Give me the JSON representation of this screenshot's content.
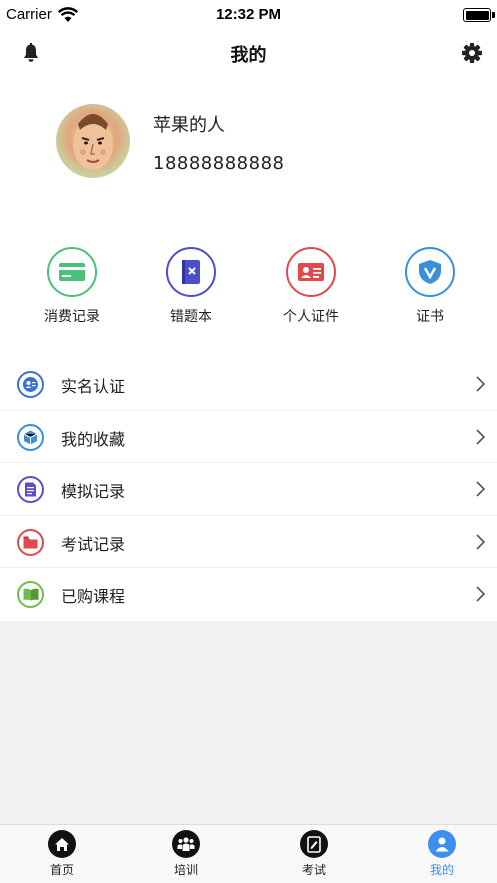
{
  "status_bar": {
    "carrier": "Carrier",
    "time": "12:32 PM"
  },
  "nav": {
    "title": "我的",
    "left_icon": "bell-icon",
    "right_icon": "gear-icon"
  },
  "profile": {
    "name": "苹果的人",
    "phone": "18888888888"
  },
  "quick_actions": [
    {
      "label": "消费记录",
      "icon": "payment-card-icon",
      "color": "#4cc17a"
    },
    {
      "label": "错题本",
      "icon": "wrong-notebook-icon",
      "color": "#4b4fc9"
    },
    {
      "label": "个人证件",
      "icon": "id-card-icon",
      "color": "#e04a4a"
    },
    {
      "label": "证书",
      "icon": "shield-certificate-icon",
      "color": "#3a8fd9"
    }
  ],
  "menu": [
    {
      "label": "实名认证",
      "icon": "identity-icon",
      "color": "#3b6fd9"
    },
    {
      "label": "我的收藏",
      "icon": "box-icon",
      "color": "#3a8fd9"
    },
    {
      "label": "模拟记录",
      "icon": "document-icon",
      "color": "#5a4fc9"
    },
    {
      "label": "考试记录",
      "icon": "folder-icon",
      "color": "#e04a4a"
    },
    {
      "label": "已购课程",
      "icon": "book-icon",
      "color": "#6cbd4a"
    }
  ],
  "tabs": [
    {
      "label": "首页",
      "icon": "home-icon",
      "active": false
    },
    {
      "label": "培训",
      "icon": "training-icon",
      "active": false
    },
    {
      "label": "考试",
      "icon": "exam-icon",
      "active": false
    },
    {
      "label": "我的",
      "icon": "profile-icon",
      "active": true
    }
  ],
  "colors": {
    "accent": "#3d8ef0",
    "inactive": "#111111",
    "background": "#f2f2f2"
  }
}
